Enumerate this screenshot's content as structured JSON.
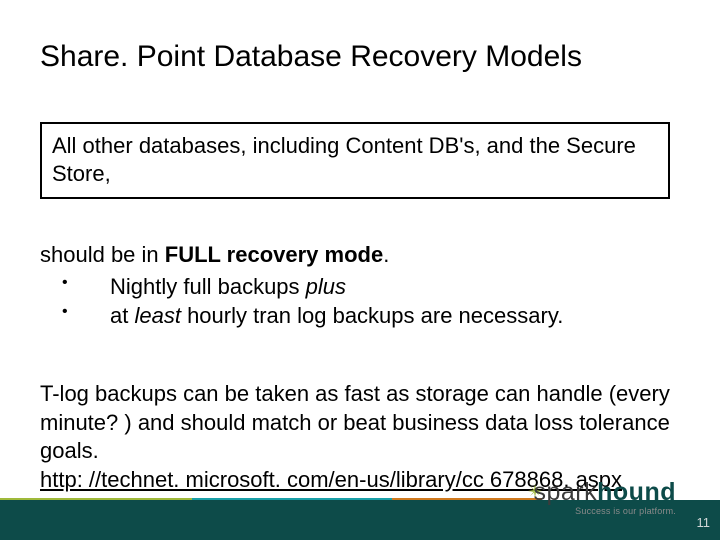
{
  "title": "Share. Point Database Recovery Models",
  "box": "All other databases, including Content DB's, and the Secure Store,",
  "body1": {
    "pre": "should be in ",
    "strong": "FULL recovery mode",
    "post": ".",
    "bullets": [
      {
        "pre": "Nightly full backups ",
        "em": "plus"
      },
      {
        "pre": "at ",
        "em": "least",
        "post": " hourly tran log backups are necessary."
      }
    ]
  },
  "body2": {
    "text": "T-log backups can be taken as fast as storage can handle (every minute? ) and should match or beat business data loss tolerance goals.",
    "link": "http: //technet. microsoft. com/en-us/library/cc 678868. aspx"
  },
  "logo": {
    "part1": "spark",
    "part2": "hound",
    "tagline": "Success is our platform."
  },
  "page_number": "11"
}
